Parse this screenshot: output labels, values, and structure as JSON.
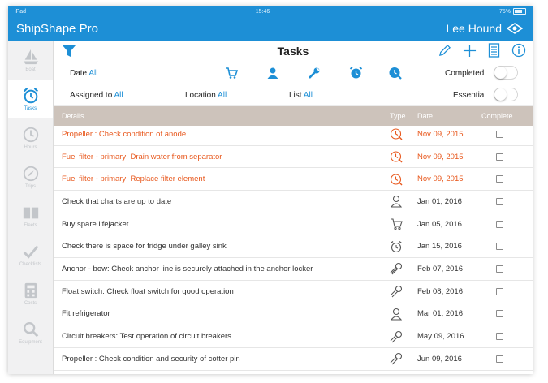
{
  "status_bar": {
    "carrier": "iPad",
    "time": "15:46",
    "battery": "75%"
  },
  "app": {
    "title": "ShipShape Pro",
    "user": "Lee Hound"
  },
  "sidebar": {
    "items": [
      {
        "label": "Boat",
        "icon": "boat-icon",
        "active": false
      },
      {
        "label": "Tasks",
        "icon": "alarm-clock-icon",
        "active": true
      },
      {
        "label": "Hours",
        "icon": "history-icon",
        "active": false
      },
      {
        "label": "Trips",
        "icon": "navigation-icon",
        "active": false
      },
      {
        "label": "Fleets",
        "icon": "book-icon",
        "active": false
      },
      {
        "label": "Checklists",
        "icon": "checkmark-icon",
        "active": false
      },
      {
        "label": "Costs",
        "icon": "calculator-icon",
        "active": false
      },
      {
        "label": "Equipment",
        "icon": "magnifier-icon",
        "active": false
      }
    ]
  },
  "toolbar": {
    "title": "Tasks"
  },
  "filters": {
    "date_label": "Date",
    "date_value": "All",
    "assigned_label": "Assigned to",
    "assigned_value": "All",
    "location_label": "Location",
    "location_value": "All",
    "list_label": "List",
    "list_value": "All",
    "completed_label": "Completed",
    "essential_label": "Essential",
    "completed_on": false,
    "essential_on": false
  },
  "table": {
    "headers": {
      "details": "Details",
      "type": "Type",
      "date": "Date",
      "complete": "Complete"
    },
    "rows": [
      {
        "details": "Propeller : Check condition of anode",
        "type": "service-clock-icon",
        "date": "Nov 09, 2015",
        "overdue": true
      },
      {
        "details": "Fuel filter - primary: Drain water from separator",
        "type": "service-clock-icon",
        "date": "Nov 09, 2015",
        "overdue": true
      },
      {
        "details": "Fuel filter - primary: Replace filter element",
        "type": "service-clock-icon",
        "date": "Nov 09, 2015",
        "overdue": true
      },
      {
        "details": "Check that charts are up to date",
        "type": "person-icon",
        "date": "Jan 01, 2016",
        "overdue": false
      },
      {
        "details": "Buy spare lifejacket",
        "type": "cart-icon",
        "date": "Jan 05, 2016",
        "overdue": false
      },
      {
        "details": "Check there is space for fridge under galley sink",
        "type": "alarm-clock-icon",
        "date": "Jan 15, 2016",
        "overdue": false
      },
      {
        "details": "Anchor - bow: Check anchor line is securely attached in the anchor locker",
        "type": "wrench-icon",
        "date": "Feb 07, 2016",
        "overdue": false
      },
      {
        "details": "Float switch: Check float switch for good operation",
        "type": "wrench-icon",
        "date": "Feb 08, 2016",
        "overdue": false
      },
      {
        "details": "Fit refrigerator",
        "type": "person-icon",
        "date": "Mar 01, 2016",
        "overdue": false
      },
      {
        "details": "Circuit breakers: Test operation of circuit breakers",
        "type": "wrench-icon",
        "date": "May 09, 2016",
        "overdue": false
      },
      {
        "details": "Propeller : Check condition and security of cotter pin",
        "type": "wrench-icon",
        "date": "Jun 09, 2016",
        "overdue": false
      }
    ]
  },
  "colors": {
    "accent": "#1d8fd6",
    "overdue": "#e8581d",
    "header_bg": "#cdc3bb",
    "sidebar_inactive": "#c3c6ca"
  }
}
